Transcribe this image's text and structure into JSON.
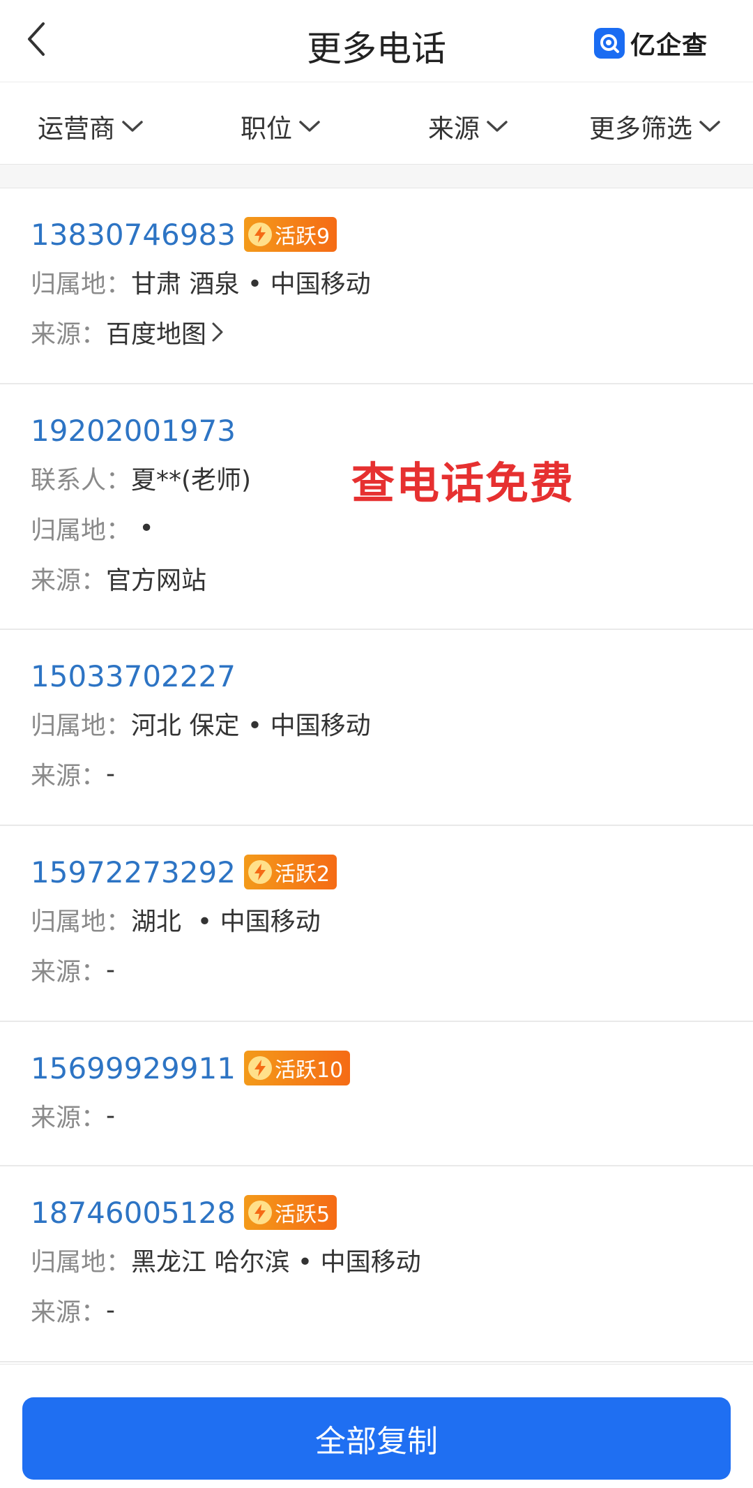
{
  "header": {
    "title": "更多电话",
    "logo_text": "亿企查"
  },
  "filters": [
    {
      "label": "运营商"
    },
    {
      "label": "职位"
    },
    {
      "label": "来源"
    },
    {
      "label": "更多筛选"
    }
  ],
  "promo_text": "查电话免费",
  "items": [
    {
      "phone": "13830746983",
      "badge": "活跃9",
      "rows": [
        {
          "label": "归属地：",
          "value": "甘肃 酒泉 • 中国移动"
        },
        {
          "label": "来源：",
          "value": "百度地图"
        }
      ]
    },
    {
      "phone": "19202001973",
      "rows": [
        {
          "label": "联系人：",
          "value": "夏**(老师)"
        },
        {
          "label": "归属地：",
          "value": " •"
        },
        {
          "label": "来源：",
          "value": "官方网站"
        }
      ]
    },
    {
      "phone": "15033702227",
      "rows": [
        {
          "label": "归属地：",
          "value": "河北 保定 • 中国移动"
        },
        {
          "label": "来源：",
          "value": "-"
        }
      ]
    },
    {
      "phone": "15972273292",
      "badge": "活跃2",
      "rows": [
        {
          "label": "归属地：",
          "value": "湖北  • 中国移动"
        },
        {
          "label": "来源：",
          "value": "-"
        }
      ]
    },
    {
      "phone": "15699929911",
      "badge": "活跃10",
      "rows": [
        {
          "label": "来源：",
          "value": "-"
        }
      ]
    },
    {
      "phone": "18746005128",
      "badge": "活跃5",
      "rows": [
        {
          "label": "归属地：",
          "value": "黑龙江 哈尔滨 • 中国移动"
        },
        {
          "label": "来源：",
          "value": "-"
        }
      ]
    }
  ],
  "footer": {
    "copy_all": "全部复制"
  },
  "colors": {
    "accent": "#1f6ff2",
    "phone": "#2d74c4",
    "badge": "#f56b15",
    "promo": "#e63030"
  }
}
